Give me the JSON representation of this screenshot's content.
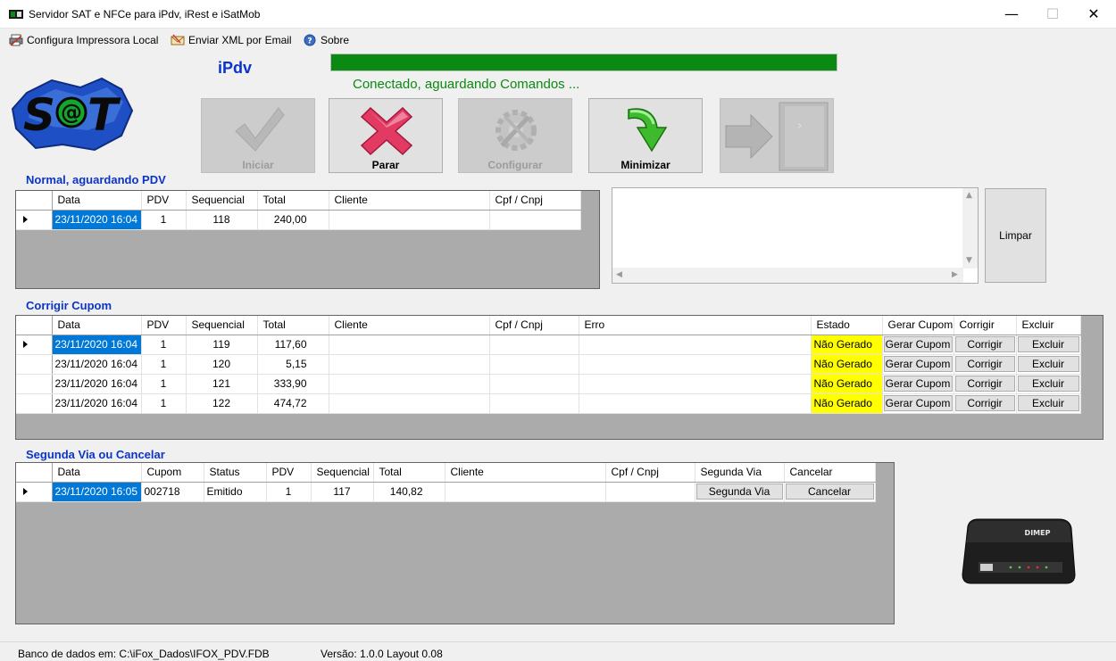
{
  "window": {
    "title": "Servidor SAT e NFCe para iPdv, iRest e iSatMob",
    "minimize": "—",
    "maximize": "☐",
    "close": "✕"
  },
  "menu": [
    {
      "label": "Configura Impressora Local",
      "icon": "printer-icon"
    },
    {
      "label": "Enviar XML por Email",
      "icon": "email-icon"
    },
    {
      "label": "Sobre",
      "icon": "help-icon"
    }
  ],
  "header": {
    "ipdv_label": "iPdv",
    "progress_fraction": 1.0,
    "status_text": "Conectado, aguardando Comandos ...",
    "progress_color": "#0a8a12"
  },
  "buttons": {
    "iniciar": "Iniciar",
    "parar": "Parar",
    "configurar": "Configurar",
    "minimizar": "Minimizar",
    "limpar": "Limpar"
  },
  "normal": {
    "title": "Normal, aguardando PDV",
    "columns": [
      "Data",
      "PDV",
      "Sequencial",
      "Total",
      "Cliente",
      "Cpf / Cnpj"
    ],
    "rows": [
      {
        "data": "23/11/2020 16:04",
        "pdv": "1",
        "sequencial": "118",
        "total": "240,00",
        "cliente": "",
        "cpf": ""
      }
    ]
  },
  "corrigir": {
    "title": "Corrigir Cupom",
    "columns": [
      "Data",
      "PDV",
      "Sequencial",
      "Total",
      "Cliente",
      "Cpf / Cnpj",
      "Erro",
      "Estado",
      "Gerar Cupom",
      "Corrigir",
      "Excluir"
    ],
    "rows": [
      {
        "data": "23/11/2020 16:04",
        "pdv": "1",
        "sequencial": "119",
        "total": "117,60",
        "cliente": "",
        "cpf": "",
        "erro": "",
        "estado": "Não Gerado",
        "gerar": "Gerar Cupom",
        "corrigir": "Corrigir",
        "excluir": "Excluir"
      },
      {
        "data": "23/11/2020 16:04",
        "pdv": "1",
        "sequencial": "120",
        "total": "5,15",
        "cliente": "",
        "cpf": "",
        "erro": "",
        "estado": "Não Gerado",
        "gerar": "Gerar Cupom",
        "corrigir": "Corrigir",
        "excluir": "Excluir"
      },
      {
        "data": "23/11/2020 16:04",
        "pdv": "1",
        "sequencial": "121",
        "total": "333,90",
        "cliente": "",
        "cpf": "",
        "erro": "",
        "estado": "Não Gerado",
        "gerar": "Gerar Cupom",
        "corrigir": "Corrigir",
        "excluir": "Excluir"
      },
      {
        "data": "23/11/2020 16:04",
        "pdv": "1",
        "sequencial": "122",
        "total": "474,72",
        "cliente": "",
        "cpf": "",
        "erro": "",
        "estado": "Não Gerado",
        "gerar": "Gerar Cupom",
        "corrigir": "Corrigir",
        "excluir": "Excluir"
      }
    ]
  },
  "segunda": {
    "title": "Segunda Via ou Cancelar",
    "columns": [
      "Data",
      "Cupom",
      "Status",
      "PDV",
      "Sequencial",
      "Total",
      "Cliente",
      "Cpf / Cnpj",
      "Segunda Via",
      "Cancelar"
    ],
    "rows": [
      {
        "data": "23/11/2020 16:05",
        "cupom": "002718",
        "status": "Emitido",
        "pdv": "1",
        "sequencial": "117",
        "total": "140,82",
        "cliente": "",
        "cpf": "",
        "segunda": "Segunda Via",
        "cancelar": "Cancelar"
      }
    ]
  },
  "device": {
    "brand": "DIMEP"
  },
  "statusbar": {
    "db": "Banco de dados em: C:\\iFox_Dados\\IFOX_PDV.FDB",
    "version": "Versão: 1.0.0  Layout 0.08"
  },
  "colors": {
    "accent": "#0b35c9",
    "selection": "#0078d7",
    "warning": "#ffff00"
  }
}
